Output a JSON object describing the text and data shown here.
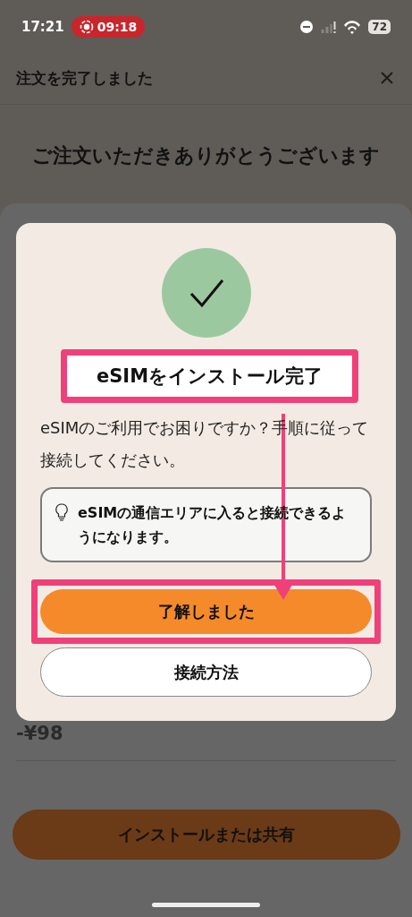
{
  "status_bar": {
    "time": "17:21",
    "recording": "09:18",
    "battery": "72"
  },
  "header": {
    "title": "注文を完了しました"
  },
  "heading": "ご注文いただきありがとうございます",
  "summary": {
    "discount": "-¥98"
  },
  "footer_button": "インストールまたは共有",
  "dialog": {
    "title": {
      "text": "eSIMをインストール完了",
      "highlighted": true
    },
    "message": "eSIMのご利用でお困りですか？手順に従って接続してください。",
    "tip": "eSIMの通信エリアに入ると接続できるようになります。",
    "buttons": [
      {
        "label": "了解しました",
        "kind": "primary",
        "highlighted": true
      },
      {
        "label": "接続方法",
        "kind": "secondary",
        "highlighted": false
      }
    ],
    "annotation_arrow": true
  }
}
